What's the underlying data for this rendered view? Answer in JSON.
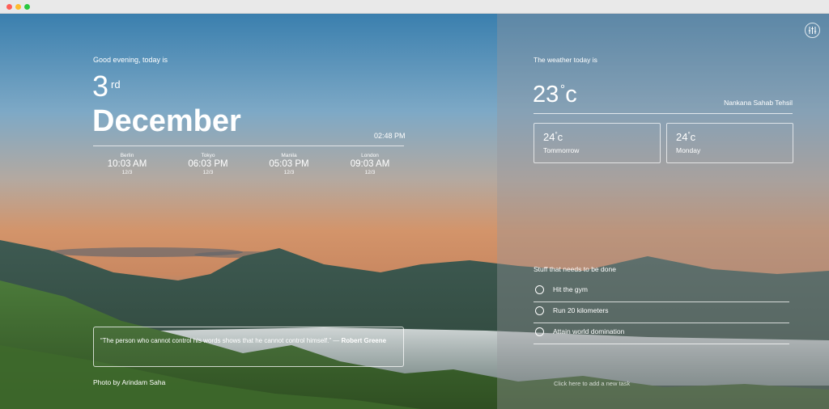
{
  "greeting": "Good evening, today is",
  "date": {
    "day": "3",
    "suffix": "rd",
    "month": "December",
    "local_time": "02:48 PM"
  },
  "world_clocks": [
    {
      "city": "Berlin",
      "time": "10:03 AM",
      "date": "12/3"
    },
    {
      "city": "Tokyo",
      "time": "06:03 PM",
      "date": "12/3"
    },
    {
      "city": "Manila",
      "time": "05:03 PM",
      "date": "12/3"
    },
    {
      "city": "London",
      "time": "09:03 AM",
      "date": "12/3"
    }
  ],
  "quote": {
    "text": "“The person who cannot control his words shows that he cannot control himself.” —",
    "author": "Robert Greene"
  },
  "photo_credit": "Photo by Arindam Saha",
  "weather": {
    "heading": "The weather today is",
    "temp": "23",
    "degree_symbol": "°",
    "unit": "c",
    "location": "Nankana Sahab Tehsil",
    "forecast": [
      {
        "temp": "24",
        "degree_symbol": "°",
        "unit": "c",
        "day": "Tommorrow"
      },
      {
        "temp": "24",
        "degree_symbol": "°",
        "unit": "c",
        "day": "Monday"
      }
    ]
  },
  "todo": {
    "heading": "Stuff that needs to be done",
    "items": [
      "Hit the gym",
      "Run 20 kilometers",
      "Attain world domination"
    ],
    "add_label": "Click here to add a new task"
  },
  "icons": {
    "settings": "sliders-icon",
    "todo_check": "circle-icon"
  },
  "colors": {
    "sky_top": "#3f86b4",
    "sunset": "#d99a6a",
    "hills": "#3d5e2f",
    "mist": "#c9cfd2"
  }
}
